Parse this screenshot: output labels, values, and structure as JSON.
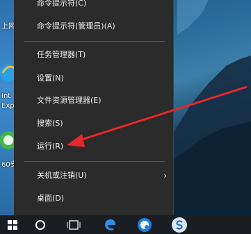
{
  "desktop": {
    "icon_labels": [
      "上网",
      "Int",
      "Exp",
      "60安"
    ]
  },
  "menu": {
    "items": [
      {
        "label": "命令提示符(C)"
      },
      {
        "label": "命令提示符(管理员)(A)"
      },
      {
        "label": "任务管理器(T)"
      },
      {
        "label": "设置(N)"
      },
      {
        "label": "文件资源管理器(E)"
      },
      {
        "label": "搜索(S)"
      },
      {
        "label": "运行(R)"
      },
      {
        "label": "关机或注销(U)",
        "submenu_glyph": "›"
      },
      {
        "label": "桌面(D)"
      }
    ]
  },
  "taskbar": {
    "icons": [
      "windows-start-icon",
      "cortana-circle-icon",
      "task-view-icon",
      "edge-icon",
      "browser-icon",
      "sogou-icon"
    ]
  },
  "annotation": {
    "arrow_color": "#e8262c"
  }
}
